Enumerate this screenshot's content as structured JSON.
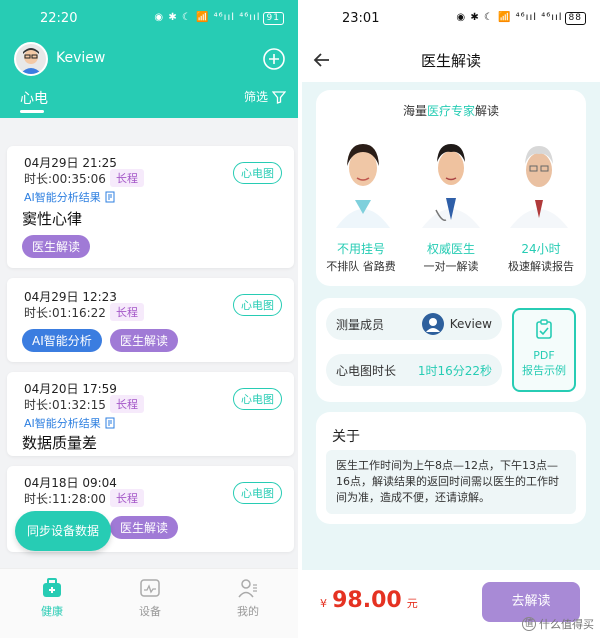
{
  "left": {
    "status_time": "22:20",
    "status_icons": "◉ ✱ ☾ 📶 ⁴⁶ııl ⁴⁶ııl",
    "battery": "91",
    "username": "Keview",
    "tab": "心电",
    "filter": "筛选",
    "records": [
      {
        "date": "04月29日 21:25",
        "duration": "时长:00:35:06",
        "tag": "长程",
        "ecg": "心电图",
        "ai": "AI智能分析结果",
        "result": "窦性心律",
        "btn": "医生解读"
      },
      {
        "date": "04月29日 12:23",
        "duration": "时长:01:16:22",
        "tag": "长程",
        "ecg": "心电图",
        "btn_ai": "AI智能分析",
        "btn": "医生解读"
      },
      {
        "date": "04月20日 17:59",
        "duration": "时长:01:32:15",
        "tag": "长程",
        "ecg": "心电图",
        "ai": "AI智能分析结果",
        "result": "数据质量差"
      },
      {
        "date": "04月18日 09:04",
        "duration": "时长:11:28:00",
        "tag": "长程",
        "ecg": "心电图",
        "btn": "医生解读"
      }
    ],
    "sync": "同步设备数据",
    "nav": [
      "健康",
      "设备",
      "我的"
    ]
  },
  "right": {
    "status_time": "23:01",
    "status_icons": "◉ ✱ ☾ 📶 ⁴⁶ııl ⁴⁶ııl",
    "battery": "88",
    "title": "医生解读",
    "headline_pre": "海量",
    "headline_hl": "医疗专家",
    "headline_post": "解读",
    "features": [
      {
        "title": "不用挂号",
        "sub": "不排队 省路费"
      },
      {
        "title": "权威医生",
        "sub": "一对一解读"
      },
      {
        "title": "24小时",
        "sub": "极速解读报告"
      }
    ],
    "member_label": "测量成员",
    "member_name": "Keview",
    "duration_label": "心电图时长",
    "duration_value": "1时16分22秒",
    "pdf_1": "PDF",
    "pdf_2": "报告示例",
    "about_title": "关于",
    "about_text": "医生工作时间为上午8点—12点，下午13点—16点，解读结果的返回时间需以医生的工作时间为准，造成不便，还请谅解。",
    "price_symbol": "¥",
    "price": "98.00",
    "price_unit": "元",
    "go_button": "去解读",
    "watermark": "什么值得买"
  },
  "colors": {
    "accent": "#27ccb4",
    "purple": "#a07ad6",
    "blue": "#3b7de0",
    "price": "#e53222"
  }
}
